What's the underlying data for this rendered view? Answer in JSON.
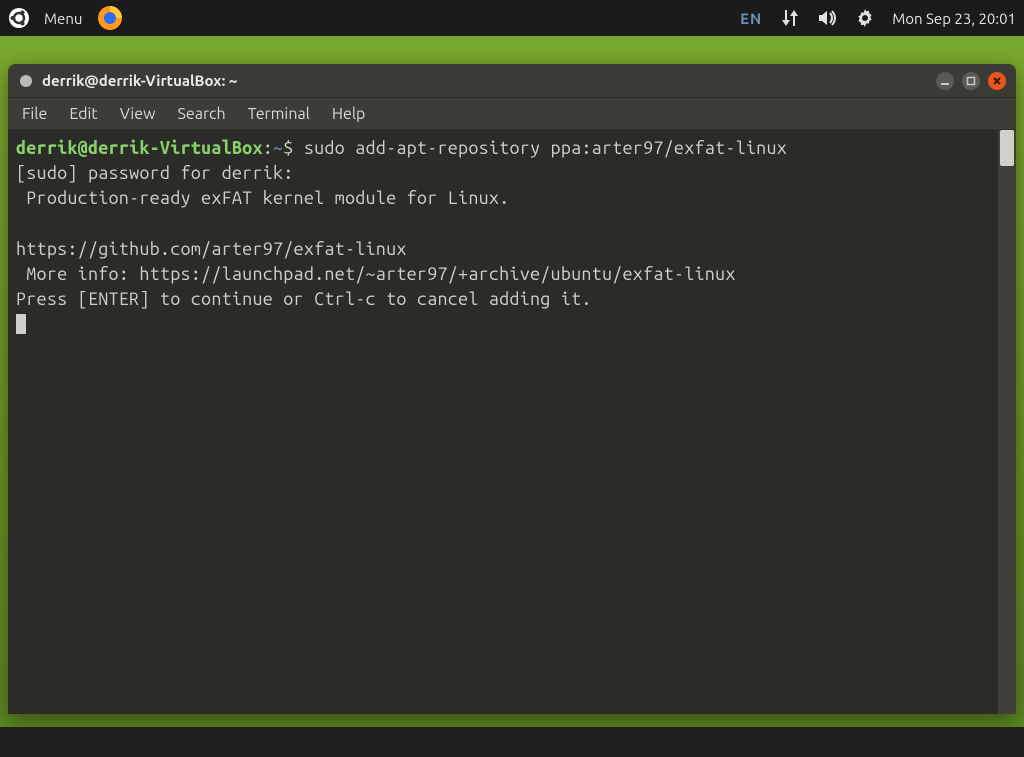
{
  "panel": {
    "menu_label": "Menu",
    "language": "EN",
    "clock": "Mon Sep 23, 20:01"
  },
  "window": {
    "title": "derrik@derrik-VirtualBox: ~"
  },
  "menubar": {
    "file": "File",
    "edit": "Edit",
    "view": "View",
    "search": "Search",
    "terminal": "Terminal",
    "help": "Help"
  },
  "terminal": {
    "prompt_userhost": "derrik@derrik-VirtualBox",
    "prompt_sep": ":",
    "prompt_path": "~",
    "prompt_suffix": "$ ",
    "command": "sudo add-apt-repository ppa:arter97/exfat-linux",
    "line_sudo": "[sudo] password for derrik:",
    "line_desc": " Production-ready exFAT kernel module for Linux.",
    "line_blank": "",
    "line_url": "https://github.com/arter97/exfat-linux",
    "line_moreinfo": " More info: https://launchpad.net/~arter97/+archive/ubuntu/exfat-linux",
    "line_prompt2": "Press [ENTER] to continue or Ctrl-c to cancel adding it."
  }
}
